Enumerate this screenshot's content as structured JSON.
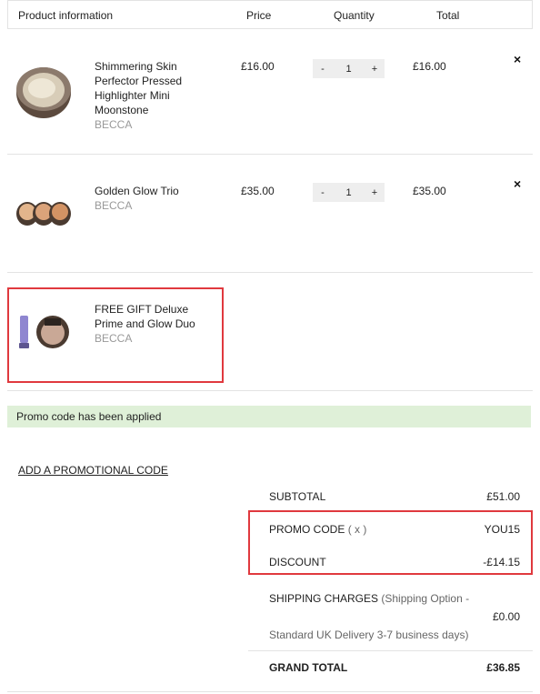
{
  "table": {
    "headers": {
      "product": "Product information",
      "price": "Price",
      "quantity": "Quantity",
      "total": "Total"
    }
  },
  "items": [
    {
      "name": "Shimmering Skin Perfector Pressed Highlighter Mini Moonstone",
      "brand": "BECCA",
      "price": "£16.00",
      "quantity": "1",
      "total": "£16.00",
      "minus": "-",
      "plus": "+",
      "remove": "×"
    },
    {
      "name": "Golden Glow Trio",
      "brand": "BECCA",
      "price": "£35.00",
      "quantity": "1",
      "total": "£35.00",
      "minus": "-",
      "plus": "+",
      "remove": "×"
    },
    {
      "name": "FREE GIFT Deluxe Prime and Glow Duo",
      "brand": "BECCA"
    }
  ],
  "notice": "Promo code has been applied",
  "promo_link": "ADD A PROMOTIONAL CODE",
  "summary": {
    "subtotal_label": "SUBTOTAL",
    "subtotal_value": "£51.00",
    "promo_label": "PROMO CODE",
    "promo_remove": "( x )",
    "promo_value": "YOU15",
    "discount_label": "DISCOUNT",
    "discount_value": "-£14.15",
    "shipping_label": "SHIPPING CHARGES",
    "shipping_option_line1": "(Shipping Option -",
    "shipping_option_line2": "Standard UK Delivery 3-7 business days)",
    "shipping_value": "£0.00",
    "grand_total_label": "GRAND TOTAL",
    "grand_total_value": "£36.85"
  },
  "colors": {
    "highlight_border": "#e0393e",
    "notice_bg": "#dff0d8",
    "brand_text": "#999999"
  }
}
